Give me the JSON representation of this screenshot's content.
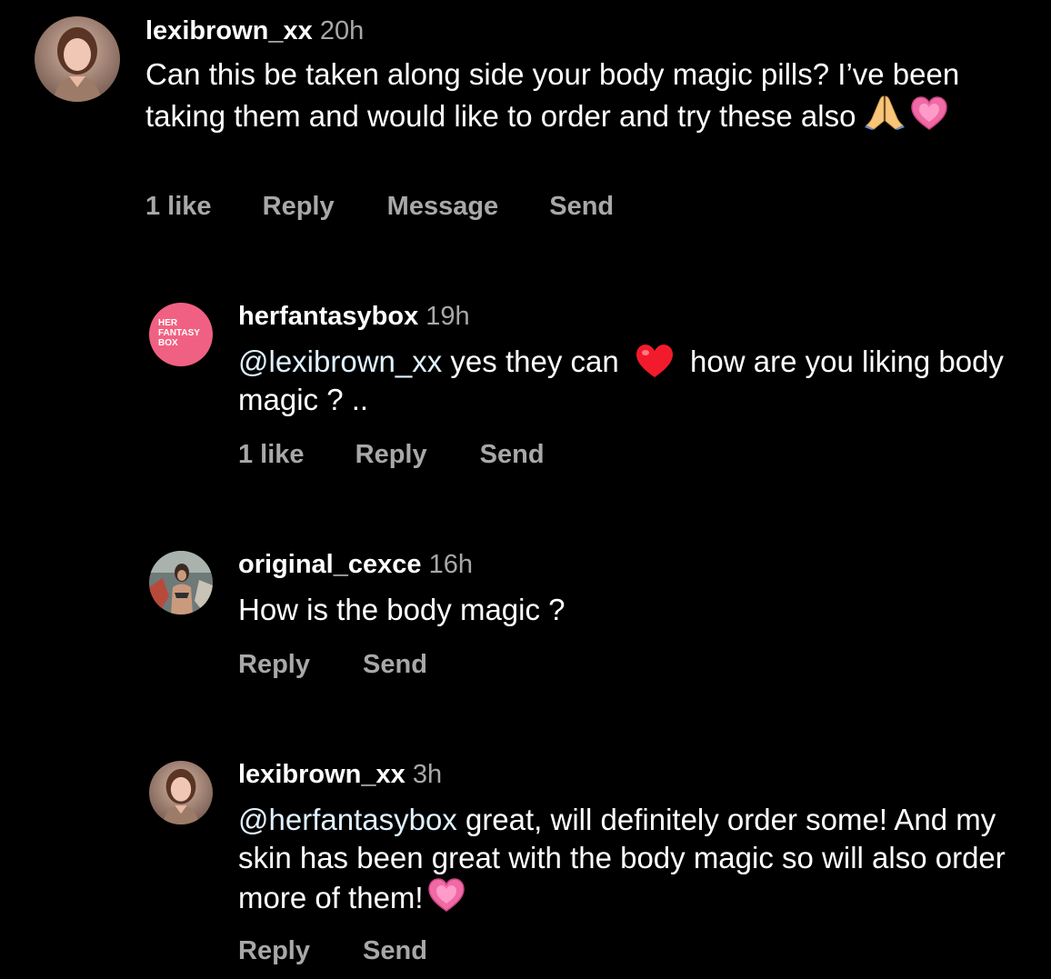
{
  "comments": [
    {
      "username": "lexibrown_xx",
      "time": "20h",
      "text": "Can this be taken along side your body magic pills? I’ve been taking them and would like to order and try these also",
      "emoji": [
        "folded-hands",
        "growing-heart"
      ],
      "actions": [
        "1 like",
        "Reply",
        "Message",
        "Send"
      ]
    },
    {
      "username": "herfantasybox",
      "time": "19h",
      "mention": "@lexibrown_xx",
      "text_a": "yes they can",
      "text_b": "how are you liking body magic ? ..",
      "emoji": [
        "red-heart"
      ],
      "avatar_text": [
        "HER",
        "FANTASY",
        "BOX"
      ],
      "actions": [
        "1 like",
        "Reply",
        "Send"
      ]
    },
    {
      "username": "original_cexce",
      "time": "16h",
      "text": "How is the body magic ?",
      "actions": [
        "Reply",
        "Send"
      ]
    },
    {
      "username": "lexibrown_xx",
      "time": "3h",
      "mention": "@herfantasybox",
      "text_a": "great, will definitely order some!",
      "text_b": "And my skin has been great with the body magic so will also order more of them!",
      "emoji": [
        "growing-heart"
      ],
      "actions": [
        "Reply",
        "Send"
      ]
    }
  ],
  "colors": {
    "background": "#000000",
    "primary_text": "#ffffff",
    "secondary_text": "#a8a8a8",
    "mention": "#e0f1ff",
    "brand_pink": "#f06082"
  }
}
